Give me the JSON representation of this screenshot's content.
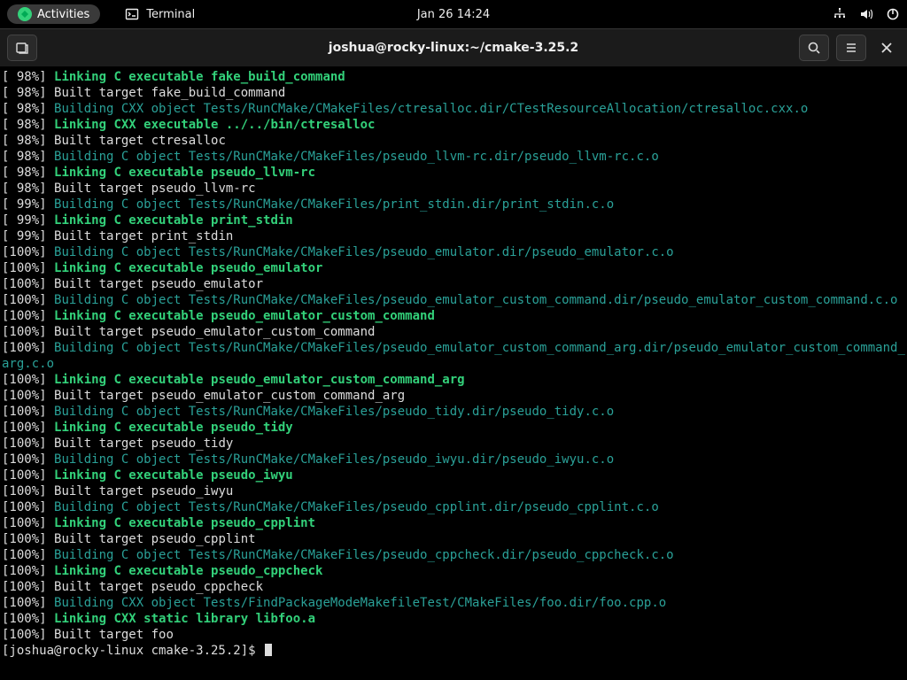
{
  "topbar": {
    "activities": "Activities",
    "app": "Terminal",
    "clock": "Jan 26  14:24"
  },
  "window": {
    "title": "joshua@rocky-linux:~/cmake-3.25.2"
  },
  "prompt": {
    "text": "[joshua@rocky-linux cmake-3.25.2]$ "
  },
  "lines": [
    {
      "pct": "[ 98%]",
      "cls": "green-b",
      "text": "Linking C executable fake_build_command"
    },
    {
      "pct": "[ 98%]",
      "cls": "white",
      "text": "Built target fake_build_command"
    },
    {
      "pct": "[ 98%]",
      "cls": "teal",
      "text": "Building CXX object Tests/RunCMake/CMakeFiles/ctresalloc.dir/CTestResourceAllocation/ctresalloc.cxx.o"
    },
    {
      "pct": "[ 98%]",
      "cls": "green-b",
      "text": "Linking CXX executable ../../bin/ctresalloc"
    },
    {
      "pct": "[ 98%]",
      "cls": "white",
      "text": "Built target ctresalloc"
    },
    {
      "pct": "[ 98%]",
      "cls": "teal",
      "text": "Building C object Tests/RunCMake/CMakeFiles/pseudo_llvm-rc.dir/pseudo_llvm-rc.c.o"
    },
    {
      "pct": "[ 98%]",
      "cls": "green-b",
      "text": "Linking C executable pseudo_llvm-rc"
    },
    {
      "pct": "[ 98%]",
      "cls": "white",
      "text": "Built target pseudo_llvm-rc"
    },
    {
      "pct": "[ 99%]",
      "cls": "teal",
      "text": "Building C object Tests/RunCMake/CMakeFiles/print_stdin.dir/print_stdin.c.o"
    },
    {
      "pct": "[ 99%]",
      "cls": "green-b",
      "text": "Linking C executable print_stdin"
    },
    {
      "pct": "[ 99%]",
      "cls": "white",
      "text": "Built target print_stdin"
    },
    {
      "pct": "[100%]",
      "cls": "teal",
      "text": "Building C object Tests/RunCMake/CMakeFiles/pseudo_emulator.dir/pseudo_emulator.c.o"
    },
    {
      "pct": "[100%]",
      "cls": "green-b",
      "text": "Linking C executable pseudo_emulator"
    },
    {
      "pct": "[100%]",
      "cls": "white",
      "text": "Built target pseudo_emulator"
    },
    {
      "pct": "[100%]",
      "cls": "teal",
      "text": "Building C object Tests/RunCMake/CMakeFiles/pseudo_emulator_custom_command.dir/pseudo_emulator_custom_command.c.o"
    },
    {
      "pct": "[100%]",
      "cls": "green-b",
      "text": "Linking C executable pseudo_emulator_custom_command"
    },
    {
      "pct": "[100%]",
      "cls": "white",
      "text": "Built target pseudo_emulator_custom_command"
    },
    {
      "pct": "[100%]",
      "cls": "teal",
      "text": "Building C object Tests/RunCMake/CMakeFiles/pseudo_emulator_custom_command_arg.dir/pseudo_emulator_custom_command_arg.c.o"
    },
    {
      "pct": "[100%]",
      "cls": "green-b",
      "text": "Linking C executable pseudo_emulator_custom_command_arg"
    },
    {
      "pct": "[100%]",
      "cls": "white",
      "text": "Built target pseudo_emulator_custom_command_arg"
    },
    {
      "pct": "[100%]",
      "cls": "teal",
      "text": "Building C object Tests/RunCMake/CMakeFiles/pseudo_tidy.dir/pseudo_tidy.c.o"
    },
    {
      "pct": "[100%]",
      "cls": "green-b",
      "text": "Linking C executable pseudo_tidy"
    },
    {
      "pct": "[100%]",
      "cls": "white",
      "text": "Built target pseudo_tidy"
    },
    {
      "pct": "[100%]",
      "cls": "teal",
      "text": "Building C object Tests/RunCMake/CMakeFiles/pseudo_iwyu.dir/pseudo_iwyu.c.o"
    },
    {
      "pct": "[100%]",
      "cls": "green-b",
      "text": "Linking C executable pseudo_iwyu"
    },
    {
      "pct": "[100%]",
      "cls": "white",
      "text": "Built target pseudo_iwyu"
    },
    {
      "pct": "[100%]",
      "cls": "teal",
      "text": "Building C object Tests/RunCMake/CMakeFiles/pseudo_cpplint.dir/pseudo_cpplint.c.o"
    },
    {
      "pct": "[100%]",
      "cls": "green-b",
      "text": "Linking C executable pseudo_cpplint"
    },
    {
      "pct": "[100%]",
      "cls": "white",
      "text": "Built target pseudo_cpplint"
    },
    {
      "pct": "[100%]",
      "cls": "teal",
      "text": "Building C object Tests/RunCMake/CMakeFiles/pseudo_cppcheck.dir/pseudo_cppcheck.c.o"
    },
    {
      "pct": "[100%]",
      "cls": "green-b",
      "text": "Linking C executable pseudo_cppcheck"
    },
    {
      "pct": "[100%]",
      "cls": "white",
      "text": "Built target pseudo_cppcheck"
    },
    {
      "pct": "[100%]",
      "cls": "teal",
      "text": "Building CXX object Tests/FindPackageModeMakefileTest/CMakeFiles/foo.dir/foo.cpp.o"
    },
    {
      "pct": "[100%]",
      "cls": "green-b",
      "text": "Linking CXX static library libfoo.a"
    },
    {
      "pct": "[100%]",
      "cls": "white",
      "text": "Built target foo"
    }
  ]
}
